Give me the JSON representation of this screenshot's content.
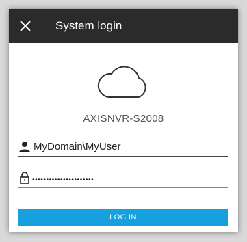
{
  "dialog": {
    "title": "System login",
    "close_icon": "close-icon"
  },
  "server": {
    "icon": "cloud-icon",
    "name": "AXISNVR-S2008"
  },
  "username": {
    "icon": "user-icon",
    "value": "MyDomain\\MyUser"
  },
  "password": {
    "icon": "lock-icon",
    "masked_value": "••••••••••••••••••••••"
  },
  "login_button": {
    "label": "LOG IN"
  },
  "colors": {
    "titlebar": "#2b2b2b",
    "accent": "#16a0dd",
    "focus_underline": "#29a3d6"
  }
}
